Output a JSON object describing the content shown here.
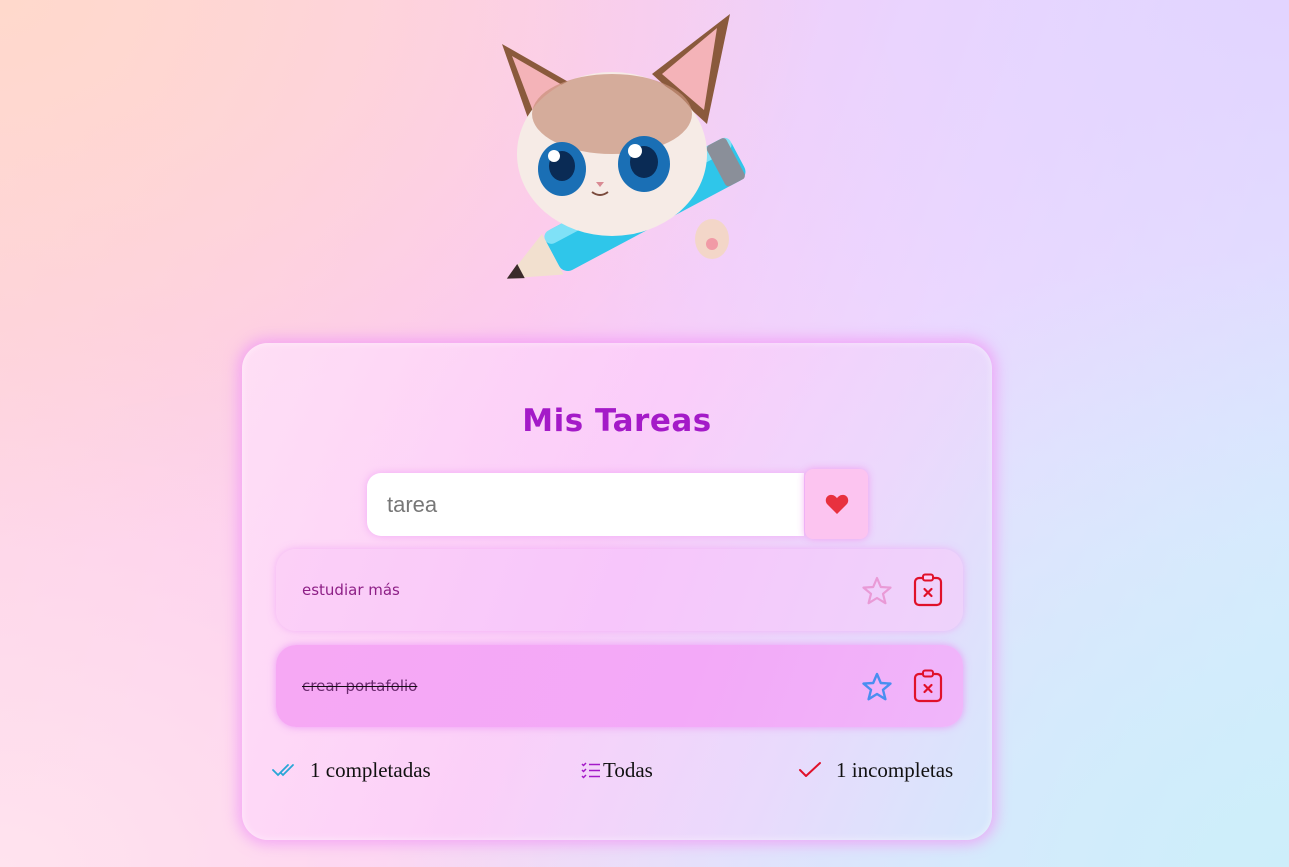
{
  "header": {
    "mascot_icon": "cat-on-pencil-icon"
  },
  "card": {
    "title": "Mis Tareas",
    "input": {
      "value": "",
      "placeholder": "tarea"
    },
    "add_button_icon": "heart-icon",
    "tasks": [
      {
        "text": "estudiar más",
        "completed": false,
        "starred": false
      },
      {
        "text": "crear portafolio",
        "completed": true,
        "starred": true
      }
    ],
    "footer": {
      "completed_label": "1 completadas",
      "all_label": "Todas",
      "incomplete_label": "1 incompletas"
    }
  },
  "colors": {
    "title": "#a41ac8",
    "heart": "#e8313f",
    "star_active": "#4a8ef0",
    "star_inactive": "#e99ad6",
    "delete": "#e0112a",
    "check_completed": "#29a6d6",
    "check_incomplete": "#e0112a",
    "list_icon": "#a41ac8"
  }
}
